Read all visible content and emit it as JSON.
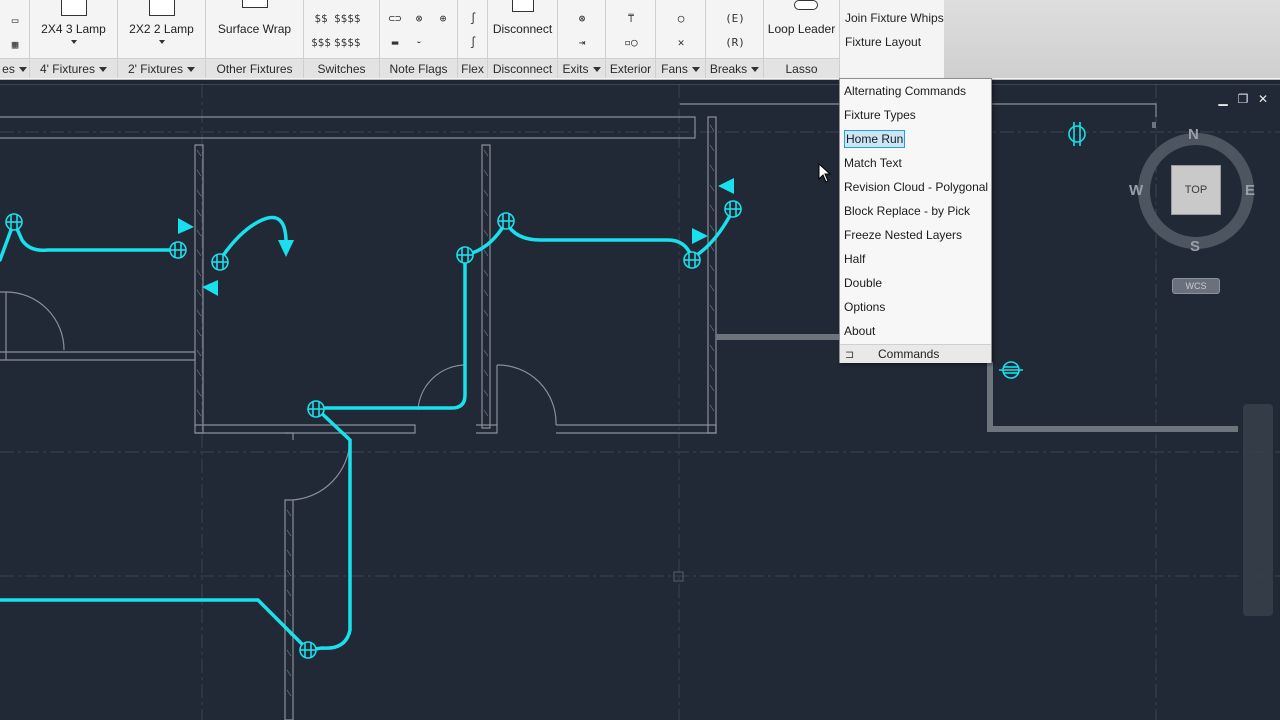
{
  "ribbon": {
    "big_buttons": [
      {
        "label": "2X4 3 Lamp"
      },
      {
        "label": "2X2 2 Lamp"
      },
      {
        "label": "Surface Wrap"
      },
      {
        "label": "Disconnect"
      },
      {
        "label": "Loop Leader"
      }
    ],
    "panels": [
      {
        "label": "es",
        "has_dropdown": true
      },
      {
        "label": "4' Fixtures",
        "has_dropdown": true
      },
      {
        "label": "2' Fixtures",
        "has_dropdown": true
      },
      {
        "label": "Other Fixtures",
        "has_dropdown": false
      },
      {
        "label": "Switches",
        "has_dropdown": false
      },
      {
        "label": "Note Flags",
        "has_dropdown": false
      },
      {
        "label": "Flex",
        "has_dropdown": false
      },
      {
        "label": "Disconnect",
        "has_dropdown": false
      },
      {
        "label": "Exits",
        "has_dropdown": true
      },
      {
        "label": "Exterior",
        "has_dropdown": false
      },
      {
        "label": "Fans",
        "has_dropdown": true
      },
      {
        "label": "Breaks",
        "has_dropdown": true
      },
      {
        "label": "Lasso",
        "has_dropdown": false
      }
    ],
    "switch_icons": [
      "$$",
      "$$$$",
      "$$$",
      "$$$$"
    ],
    "break_icons": [
      "(E)",
      "(R)"
    ],
    "side_links": [
      "Join Fixture Whips",
      "Fixture Layout"
    ]
  },
  "window_controls": [
    "minimize",
    "restore",
    "close"
  ],
  "viewcube": {
    "top_label": "TOP",
    "north": "N",
    "south": "S",
    "east": "E",
    "west": "W",
    "wcs_label": "WCS"
  },
  "menu": {
    "items": [
      {
        "label": "Alternating Commands",
        "selected": false
      },
      {
        "label": "Fixture Types",
        "selected": false
      },
      {
        "label": "Home Run",
        "selected": true
      },
      {
        "label": "Match Text",
        "selected": false
      },
      {
        "label": "Revision Cloud - Polygonal",
        "selected": false
      },
      {
        "label": "Block Replace - by Pick",
        "selected": false
      },
      {
        "label": "Freeze Nested Layers",
        "selected": false
      },
      {
        "label": "Half",
        "selected": false
      },
      {
        "label": "Double",
        "selected": false
      },
      {
        "label": "Options",
        "selected": false
      },
      {
        "label": "About",
        "selected": false
      }
    ],
    "footer_label": "Commands"
  },
  "colors": {
    "canvas_bg": "#212836",
    "wire": "#19e0ec",
    "wall": "#8a9098",
    "grid": "#3a4250",
    "ribbon_bg": "#f4f4f4",
    "menu_selected_bg": "#cde6f7",
    "menu_selected_border": "#26a0da"
  }
}
